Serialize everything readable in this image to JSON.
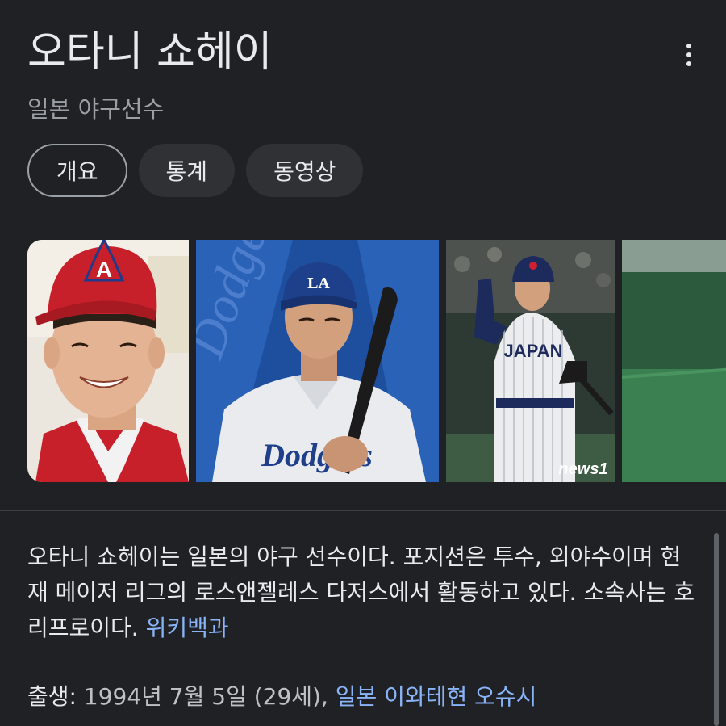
{
  "header": {
    "title": "오타니 쇼헤이",
    "subtitle": "일본 야구선수",
    "more_icon": "more-vert-icon"
  },
  "tabs": [
    {
      "label": "개요",
      "active": true
    },
    {
      "label": "통계",
      "active": false
    },
    {
      "label": "동영상",
      "active": false
    }
  ],
  "gallery": {
    "watermark": "news1"
  },
  "description": {
    "text": "오타니 쇼헤이는 일본의 야구 선수이다. 포지션은 투수, 외야수이며 현재 메이저 리그의 로스앤젤레스 다저스에서 활동하고 있다. 소속사는 호리프로이다.",
    "source_link": "위키백과"
  },
  "born": {
    "label": "출생",
    "value": "1994년 7월 5일 (29세),",
    "place_link": "일본 이와테현 오슈시"
  },
  "colors": {
    "background": "#202124",
    "text": "#e8eaed",
    "secondary_text": "#9aa0a6",
    "link": "#8ab4f8",
    "chip": "#303134"
  }
}
